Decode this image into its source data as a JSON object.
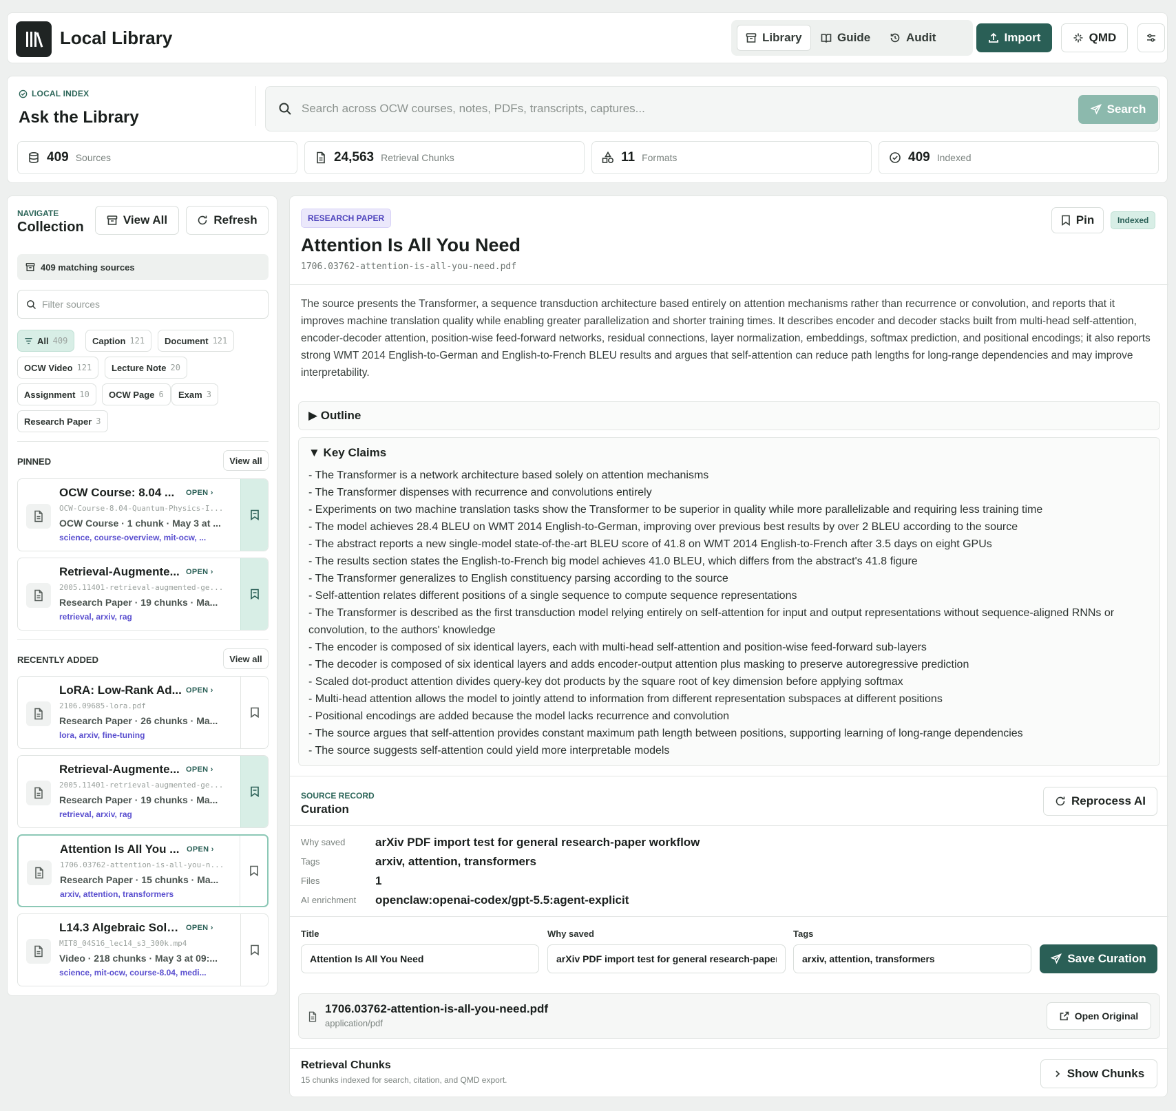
{
  "header": {
    "title": "Local Library",
    "nav": [
      {
        "label": "Library",
        "icon": "archive-icon",
        "active": true
      },
      {
        "label": "Guide",
        "icon": "book-icon",
        "active": false
      },
      {
        "label": "Audit",
        "icon": "history-icon",
        "active": false
      }
    ],
    "import_label": "Import",
    "qmd_label": "QMD"
  },
  "search": {
    "kicker": "LOCAL INDEX",
    "title": "Ask the Library",
    "placeholder": "Search across OCW courses, notes, PDFs, transcripts, captures...",
    "button_label": "Search"
  },
  "stats": [
    {
      "value": "409",
      "label": "Sources",
      "icon": "database-icon"
    },
    {
      "value": "24,563",
      "label": "Retrieval Chunks",
      "icon": "file-icon"
    },
    {
      "value": "11",
      "label": "Formats",
      "icon": "shapes-icon"
    },
    {
      "value": "409",
      "label": "Indexed",
      "icon": "check-circle-icon"
    }
  ],
  "sidebar": {
    "kicker": "NAVIGATE",
    "title": "Collection",
    "view_all_label": "View All",
    "refresh_label": "Refresh",
    "matching_text": "409 matching sources",
    "filter_placeholder": "Filter sources",
    "chips": [
      {
        "label": "All",
        "count": "409",
        "active": true
      },
      {
        "label": "Caption",
        "count": "121"
      },
      {
        "label": "Document",
        "count": "121"
      },
      {
        "label": "OCW Video",
        "count": "121"
      },
      {
        "label": "Lecture Note",
        "count": "20"
      },
      {
        "label": "Assignment",
        "count": "10"
      },
      {
        "label": "OCW Page",
        "count": "6"
      },
      {
        "label": "Exam",
        "count": "3"
      },
      {
        "label": "Research Paper",
        "count": "3"
      }
    ],
    "pinned_label": "PINNED",
    "recent_label": "RECENTLY ADDED",
    "view_all_small": "View all",
    "open_label": "OPEN ›",
    "pinned": [
      {
        "title": "OCW Course: 8.04 ...",
        "file": "OCW-Course-8.04-Quantum-Physics-I...",
        "meta": "OCW Course · 1 chunk · May 3 at ...",
        "tags": "science, course-overview, mit-ocw, ...",
        "pinned": true
      },
      {
        "title": "Retrieval-Augmente...",
        "file": "2005.11401-retrieval-augmented-ge...",
        "meta": "Research Paper · 19 chunks · Ma...",
        "tags": "retrieval, arxiv, rag",
        "pinned": true
      }
    ],
    "recent": [
      {
        "title": "LoRA: Low-Rank Ad...",
        "file": "2106.09685-lora.pdf",
        "meta": "Research Paper · 26 chunks · Ma...",
        "tags": "lora, arxiv, fine-tuning",
        "pinned": false
      },
      {
        "title": "Retrieval-Augmente...",
        "file": "2005.11401-retrieval-augmented-ge...",
        "meta": "Research Paper · 19 chunks · Ma...",
        "tags": "retrieval, arxiv, rag",
        "pinned": true
      },
      {
        "title": "Attention Is All You ...",
        "file": "1706.03762-attention-is-all-you-n...",
        "meta": "Research Paper · 15 chunks · Ma...",
        "tags": "arxiv, attention, transformers",
        "pinned": false,
        "selected": true
      },
      {
        "title": "L14.3 Algebraic Solu...",
        "file": "MIT8_04S16_lec14_s3_300k.mp4",
        "meta": "Video · 218 chunks · May 3 at 09:...",
        "tags": "science, mit-ocw, course-8.04, medi...",
        "pinned": false
      }
    ]
  },
  "doc": {
    "badge": "RESEARCH PAPER",
    "title": "Attention Is All You Need",
    "file": "1706.03762-attention-is-all-you-need.pdf",
    "pin_label": "Pin",
    "status": "Indexed",
    "summary": "The source presents the Transformer, a sequence transduction architecture based entirely on attention mechanisms rather than recurrence or convolution, and reports that it improves machine translation quality while enabling greater parallelization and shorter training times. It describes encoder and decoder stacks built from multi-head self-attention, encoder-decoder attention, position-wise feed-forward networks, residual connections, layer normalization, embeddings, softmax prediction, and positional encodings; it also reports strong WMT 2014 English-to-German and English-to-French BLEU results and argues that self-attention can reduce path lengths for long-range dependencies and may improve interpretability.",
    "outline_label": "▶ Outline",
    "claims_label": "▼ Key Claims",
    "claims": [
      "- The Transformer is a network architecture based solely on attention mechanisms",
      "- The Transformer dispenses with recurrence and convolutions entirely",
      "- Experiments on two machine translation tasks show the Transformer to be superior in quality while more parallelizable and requiring less training time",
      "- The model achieves 28.4 BLEU on WMT 2014 English-to-German, improving over previous best results by over 2 BLEU according to the source",
      "- The abstract reports a new single-model state-of-the-art BLEU score of 41.8 on WMT 2014 English-to-French after 3.5 days on eight GPUs",
      "- The results section states the English-to-French big model achieves 41.0 BLEU, which differs from the abstract's 41.8 figure",
      "- The Transformer generalizes to English constituency parsing according to the source",
      "- Self-attention relates different positions of a single sequence to compute sequence representations",
      "- The Transformer is described as the first transduction model relying entirely on self-attention for input and output representations without sequence-aligned RNNs or convolution, to the authors' knowledge",
      "- The encoder is composed of six identical layers, each with multi-head self-attention and position-wise feed-forward sub-layers",
      "- The decoder is composed of six identical layers and adds encoder-output attention plus masking to preserve autoregressive prediction",
      "- Scaled dot-product attention divides query-key dot products by the square root of key dimension before applying softmax",
      "- Multi-head attention allows the model to jointly attend to information from different representation subspaces at different positions",
      "- Positional encodings are added because the model lacks recurrence and convolution",
      "- The source argues that self-attention provides constant maximum path length between positions, supporting learning of long-range dependencies",
      "- The source suggests self-attention could yield more interpretable models"
    ],
    "curation": {
      "kicker": "SOURCE RECORD",
      "title": "Curation",
      "reprocess_label": "Reprocess AI",
      "why_saved_key": "Why saved",
      "why_saved": "arXiv PDF import test for general research-paper workflow",
      "tags_key": "Tags",
      "tags": "arxiv, attention, transformers",
      "files_key": "Files",
      "files": "1",
      "ai_key": "AI enrichment",
      "ai": "openclaw:openai-codex/gpt-5.5:agent-explicit"
    },
    "form": {
      "title_label": "Title",
      "title_value": "Attention Is All You Need",
      "why_label": "Why saved",
      "why_value": "arXiv PDF import test for general research-paper workflow",
      "tags_label": "Tags",
      "tags_value": "arxiv, attention, transformers",
      "save_label": "Save Curation"
    },
    "attachment": {
      "name": "1706.03762-attention-is-all-you-need.pdf",
      "mime": "application/pdf",
      "open_label": "Open Original"
    },
    "chunks": {
      "title": "Retrieval Chunks",
      "subtitle": "15 chunks indexed for search, citation, and QMD export.",
      "button_label": "Show Chunks"
    }
  }
}
